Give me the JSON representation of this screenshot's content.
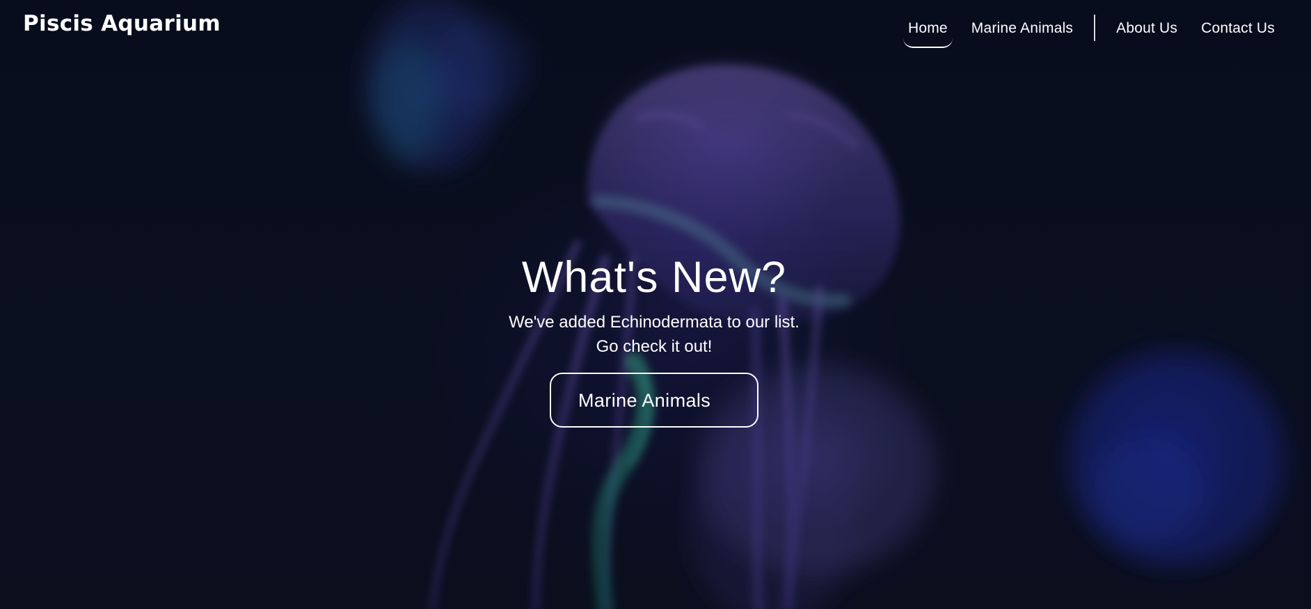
{
  "brand": {
    "name": "Piscis Aquarium"
  },
  "nav": {
    "items": [
      {
        "label": "Home",
        "active": true
      },
      {
        "label": "Marine Animals",
        "active": false
      },
      {
        "label": "About Us",
        "active": false
      },
      {
        "label": "Contact Us",
        "active": false
      }
    ]
  },
  "hero": {
    "headline": "What's New?",
    "subtext_line_1": "We've added Echinodermata to our list.",
    "subtext_line_2": "Go check it out!",
    "cta_label": "Marine Animals",
    "background_image_semantics": "jellyfish"
  },
  "colors": {
    "background": "#0b0f1e",
    "text": "#ffffff",
    "jellyfish_tint": "#5b49b3"
  }
}
